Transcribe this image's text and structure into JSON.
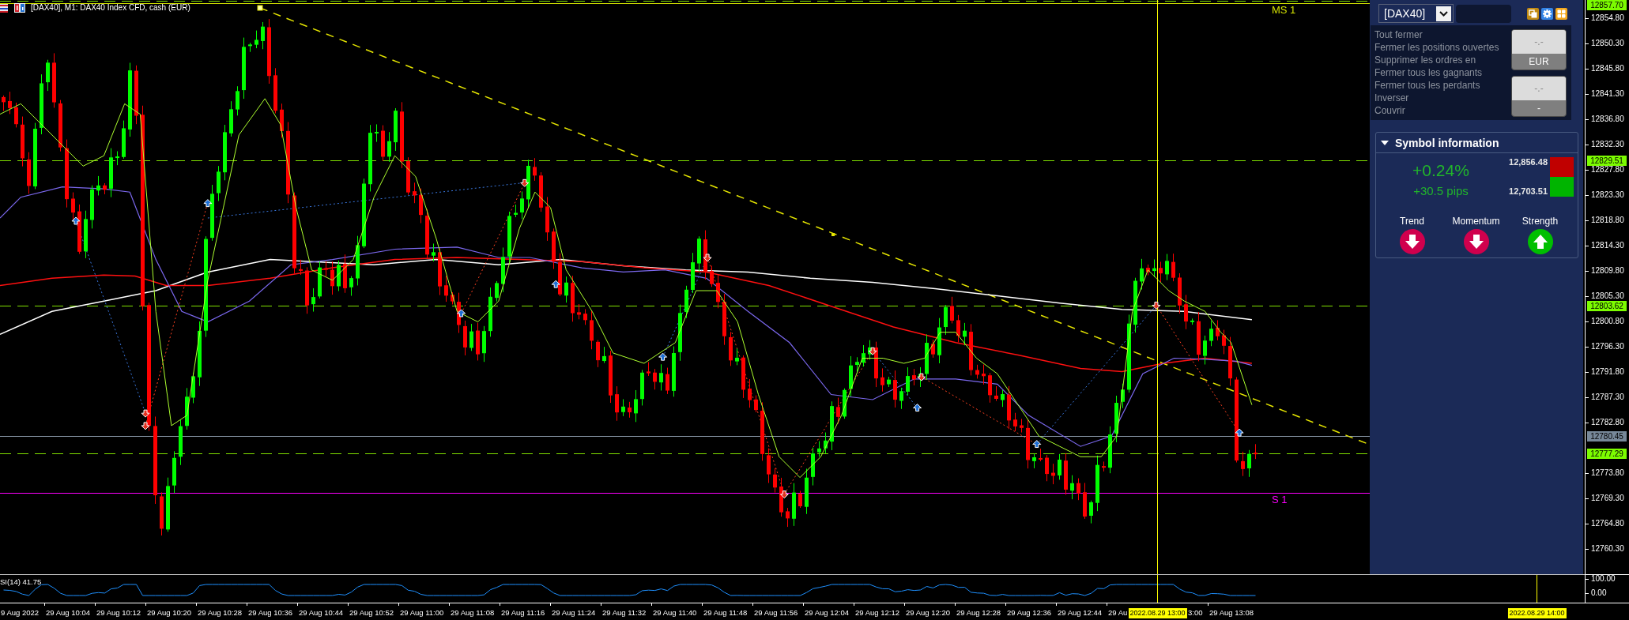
{
  "chart": {
    "title": "[DAX40], M1: DAX40 Index CFD, cash (EUR)",
    "pivots": [
      {
        "label": "MS 1",
        "kind": "resistance"
      },
      {
        "label": "S 1",
        "kind": "support"
      }
    ]
  },
  "panel": {
    "symbol": "[DAX40]",
    "actions": [
      "Tout fermer",
      "Fermer les positions ouvertes",
      "Supprimer les ordres en",
      "Fermer tous les gagnants",
      "Fermer tous les perdants",
      "Inverser",
      "Couvrir"
    ],
    "buttons": [
      {
        "value": "-.-",
        "unit": "EUR"
      },
      {
        "value": "-.-",
        "unit": "-"
      }
    ],
    "symbol_info": {
      "title": "Symbol information",
      "expanded": true,
      "change_percent": "+0.24%",
      "change_pips": "+30.5 pips",
      "high": "12,856.48",
      "low": "12,703.51",
      "indicators": [
        {
          "label": "Trend",
          "rising": false
        },
        {
          "label": "Momentum",
          "rising": false
        },
        {
          "label": "Strength",
          "rising": true
        }
      ]
    }
  },
  "price_axis": {
    "labels": [
      "12854.80",
      "12850.30",
      "12845.80",
      "12841.30",
      "12836.80",
      "12832.30",
      "12827.80",
      "12823.30",
      "12818.80",
      "12814.30",
      "12809.80",
      "12805.30",
      "12800.80",
      "12796.30",
      "12791.80",
      "12787.30",
      "12782.80",
      "12773.80",
      "12769.30",
      "12764.80",
      "12760.30"
    ],
    "markers": [
      {
        "text": "12857.70",
        "kind": "level"
      },
      {
        "text": "12829.51",
        "kind": "level"
      },
      {
        "text": "12803.62",
        "kind": "level"
      },
      {
        "text": "12780.45",
        "kind": "bid"
      },
      {
        "text": "12777.29",
        "kind": "level"
      }
    ]
  },
  "rsi": {
    "label": "SI(14) 41.75",
    "axis_labels": [
      "100.00",
      "0.00"
    ]
  },
  "time_axis": {
    "labels": [
      "9 Aug 2022",
      "29 Aug 10:04",
      "29 Aug 10:12",
      "29 Aug 10:20",
      "29 Aug 10:28",
      "29 Aug 10:36",
      "29 Aug 10:44",
      "29 Aug 10:52",
      "29 Aug 11:00",
      "29 Aug 11:08",
      "29 Aug 11:16",
      "29 Aug 11:24",
      "29 Aug 11:32",
      "29 Aug 11:40",
      "29 Aug 11:48",
      "29 Aug 11:56",
      "29 Aug 12:04",
      "29 Aug 12:12",
      "29 Aug 12:20",
      "29 Aug 12:28",
      "29 Aug 12:36",
      "29 Aug 12:44",
      "29 Au"
    ],
    "cursor_labels": [
      "2022.08.29 13:00",
      "2022.08.29 14:00"
    ],
    "labels_after_cursor": [
      "3:00",
      "29 Aug 13:08"
    ]
  }
}
